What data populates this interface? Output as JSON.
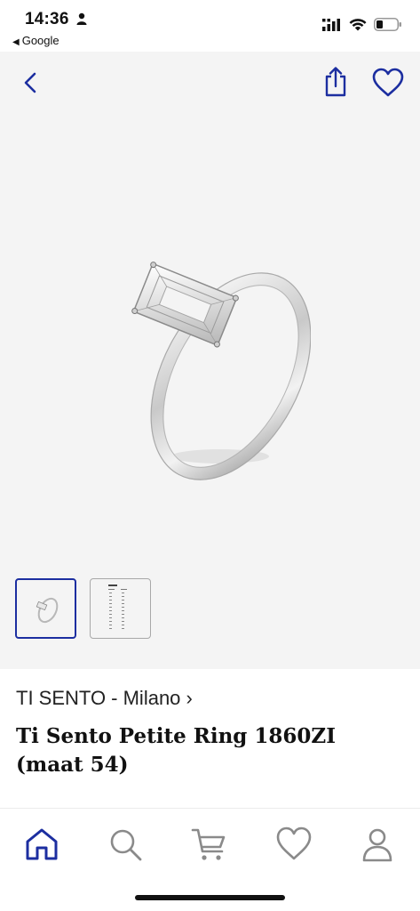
{
  "status_bar": {
    "time": "14:36",
    "back_app": "Google",
    "icons": [
      "person-icon",
      "cellular-signal-icon",
      "wifi-icon",
      "battery-icon"
    ]
  },
  "header": {
    "icons": [
      "chevron-left-icon",
      "share-icon",
      "heart-icon"
    ],
    "accent_color": "#1c2ea0"
  },
  "gallery": {
    "thumbnails": [
      "ring-thumbnail",
      "size-chart-thumbnail"
    ],
    "selected_index": 0
  },
  "product": {
    "brand_link": "TI SENTO - Milano",
    "brand_chevron": "›",
    "title_line1": "Ti Sento Petite Ring 1860ZI",
    "title_line2": "(maat 54)"
  },
  "tab_bar": {
    "tabs": [
      "home-icon",
      "search-icon",
      "cart-icon",
      "heart-icon",
      "profile-icon"
    ],
    "active_tab": "home-icon"
  }
}
